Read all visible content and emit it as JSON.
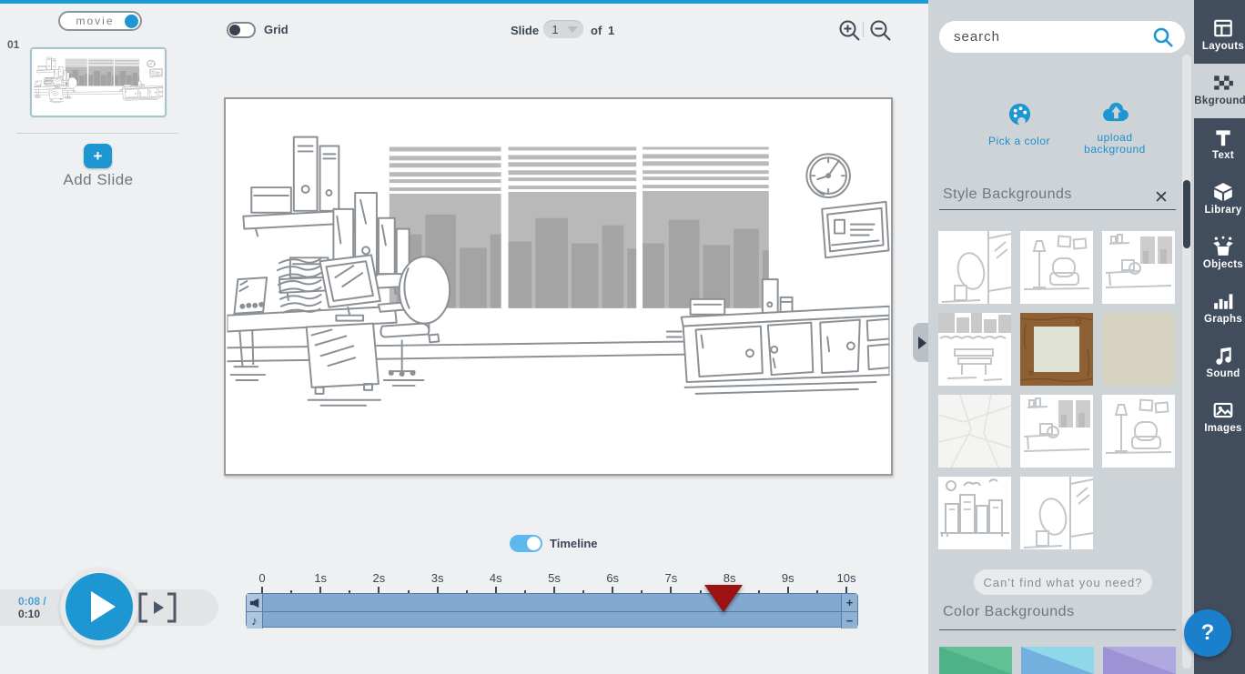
{
  "colors": {
    "accent_blue": "#1e96d2",
    "toggle_blue": "#5cb8ee",
    "top_strip": "#1d9ad2",
    "panel_bg": "#ced3d7",
    "sidebar_bg": "#414c5c",
    "timeline_track": "#82a9cf",
    "playhead_red": "#9c1111",
    "help_blue": "#1b80cc"
  },
  "slides_panel": {
    "mode_label": "movie",
    "slide_number": "01",
    "add_glyph": "+",
    "add_label": "Add Slide"
  },
  "toolbar": {
    "grid_label": "Grid",
    "slide_label": "Slide",
    "slide_value": "1",
    "of_label": "of",
    "slide_total": "1"
  },
  "playback": {
    "current": "0:08",
    "separator": "/",
    "total": "0:10"
  },
  "timeline": {
    "label": "Timeline",
    "tick_labels": [
      "0",
      "1s",
      "2s",
      "3s",
      "4s",
      "5s",
      "6s",
      "7s",
      "8s",
      "9s",
      "10s"
    ],
    "seconds_total": 10,
    "playhead_seconds": 7.9,
    "zoom_in_glyph": "+",
    "zoom_out_glyph": "−",
    "tracks": [
      {
        "icon": "speaker-icon"
      },
      {
        "icon": "music-note-icon",
        "glyph": "♪"
      }
    ]
  },
  "right_panel": {
    "search_placeholder": "search",
    "pick_color_label": "Pick a color",
    "upload_line1": "upload",
    "upload_line2": "background",
    "style_title": "Style Backgrounds",
    "close_glyph": "✕",
    "thumbnails": [
      {
        "kind": "window-corner"
      },
      {
        "kind": "armchair-lamp"
      },
      {
        "kind": "office-desk"
      },
      {
        "kind": "park-bench"
      },
      {
        "kind": "wooden-frame"
      },
      {
        "kind": "plain-beige"
      },
      {
        "kind": "crumpled-paper"
      },
      {
        "kind": "office-desk"
      },
      {
        "kind": "armchair-lamp"
      },
      {
        "kind": "city-skyline"
      },
      {
        "kind": "window-corner"
      }
    ],
    "cant_find_label": "Can't find what you need?",
    "color_title": "Color Backgrounds",
    "swatches": [
      {
        "color": "#62c096",
        "shade": "#4fb187"
      },
      {
        "color": "#8ed8ea",
        "shade": "#74b0dd"
      },
      {
        "color": "#b0a9df",
        "shade": "#9c92d4"
      }
    ]
  },
  "sidebar": {
    "items": [
      {
        "label": "Layouts",
        "icon": "layouts",
        "active": false
      },
      {
        "label": "Bkgrounds",
        "icon": "bkgrounds",
        "active": true
      },
      {
        "label": "Text",
        "icon": "text",
        "active": false
      },
      {
        "label": "Library",
        "icon": "library",
        "active": false
      },
      {
        "label": "Objects",
        "icon": "objects",
        "active": false
      },
      {
        "label": "Graphs",
        "icon": "graphs",
        "active": false
      },
      {
        "label": "Sound",
        "icon": "sound",
        "active": false
      },
      {
        "label": "Images",
        "icon": "images",
        "active": false
      }
    ]
  },
  "help": {
    "glyph": "?"
  }
}
